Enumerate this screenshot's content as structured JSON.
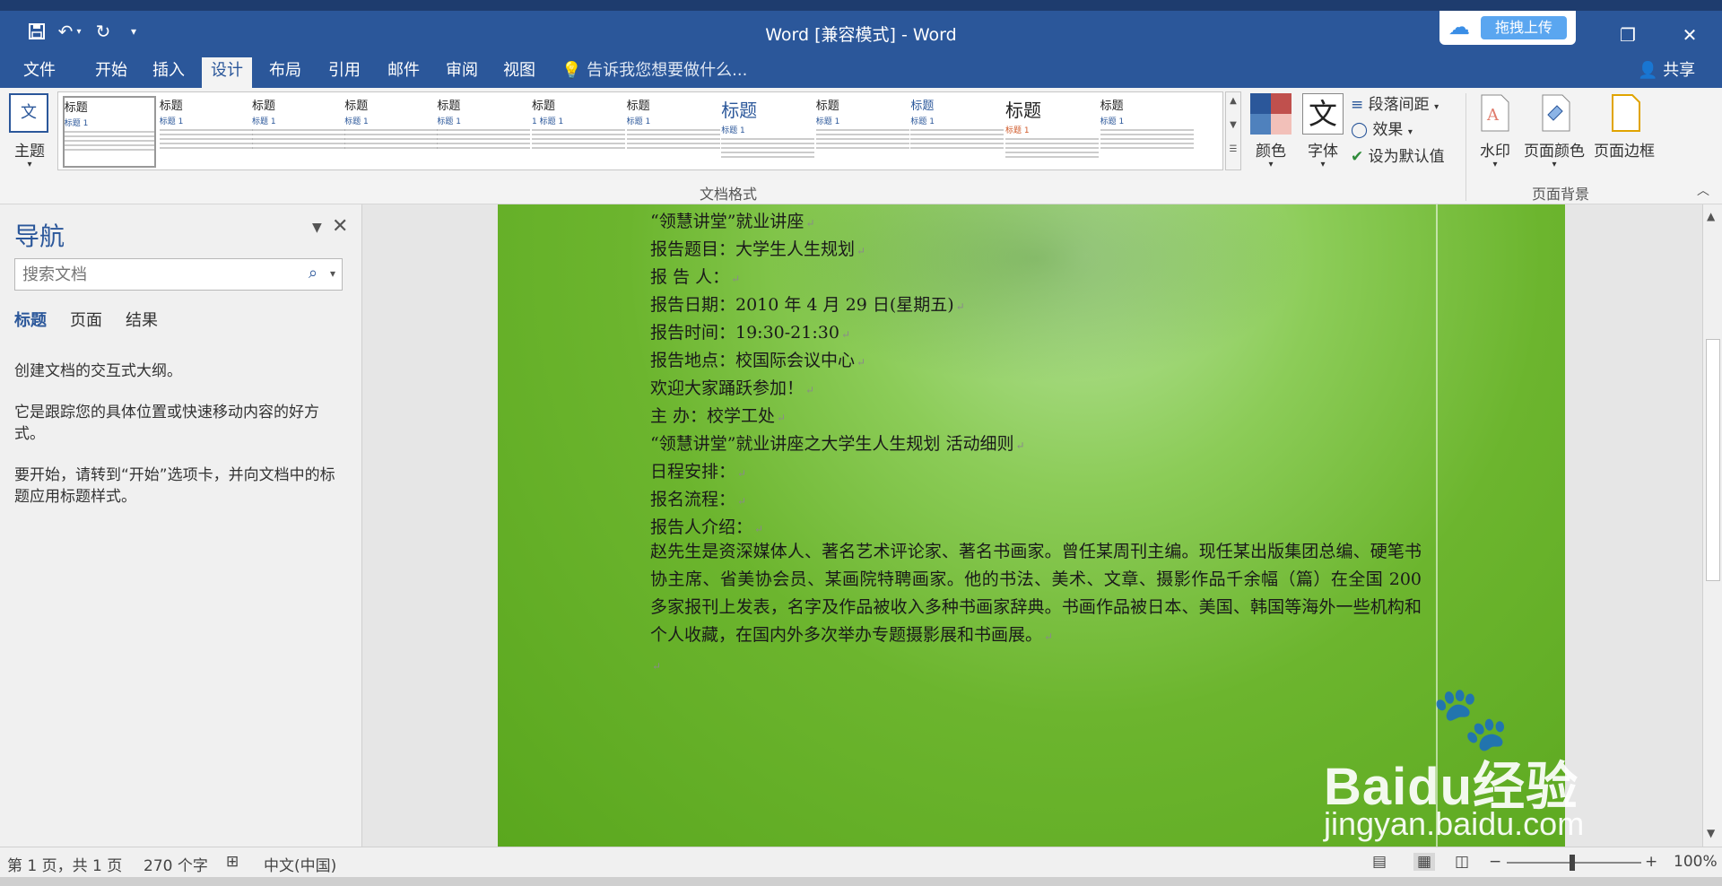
{
  "window": {
    "title": "Word [兼容模式] - Word",
    "upload_label": "拖拽上传"
  },
  "tabs": [
    {
      "label": "文件"
    },
    {
      "label": "开始"
    },
    {
      "label": "插入"
    },
    {
      "label": "设计"
    },
    {
      "label": "布局"
    },
    {
      "label": "引用"
    },
    {
      "label": "邮件"
    },
    {
      "label": "审阅"
    },
    {
      "label": "视图"
    }
  ],
  "tell_me": "告诉我您想要做什么...",
  "share": "共享",
  "ribbon": {
    "theme": "主题",
    "gallery_thumbs": [
      {
        "title": "标题",
        "sub": "标题 1"
      },
      {
        "title": "标题",
        "sub": "标题 1"
      },
      {
        "title": "标题",
        "sub": "标题 1"
      },
      {
        "title": "标题",
        "sub": "标题 1"
      },
      {
        "title": "标题",
        "sub": "标题 1"
      },
      {
        "title": "标题",
        "sub": "1 标题 1"
      },
      {
        "title": "标题",
        "sub": "标题 1"
      },
      {
        "title": "标题",
        "sub": "标题 1"
      },
      {
        "title": "标题",
        "sub": "标题 1"
      },
      {
        "title": "标题",
        "sub": "标题 1"
      },
      {
        "title": "标题",
        "sub": "标题 1"
      },
      {
        "title": "标题",
        "sub": "标题 1"
      }
    ],
    "colors": "颜色",
    "fonts": "字体",
    "fonts_glyph": "文",
    "paragraph_spacing": "段落间距",
    "effects": "效果",
    "set_default": "设为默认值",
    "watermark": "水印",
    "page_color": "页面颜色",
    "page_border": "页面边框",
    "group_doc_format": "文档格式",
    "group_page_bg": "页面背景"
  },
  "nav": {
    "title": "导航",
    "search_placeholder": "搜索文档",
    "tabs": [
      "标题",
      "页面",
      "结果"
    ],
    "text1": "创建文档的交互式大纲。",
    "text2": "它是跟踪您的具体位置或快速移动内容的好方式。",
    "text3": "要开始，请转到“开始”选项卡，并向文档中的标题应用标题样式。"
  },
  "doc": {
    "lines": [
      "“领慧讲堂”就业讲座",
      "报告题目：大学生人生规划",
      "报 告 人：",
      "报告日期：2010 年 4 月 29 日(星期五)",
      "报告时间：19:30-21:30",
      "报告地点：校国际会议中心",
      "欢迎大家踊跃参加！",
      "主 办：校学工处",
      "“领慧讲堂”就业讲座之大学生人生规划 活动细则",
      "日程安排：",
      "报名流程：",
      "报告人介绍："
    ],
    "paragraph": "赵先生是资深媒体人、著名艺术评论家、著名书画家。曾任某周刊主编。现任某出版集团总编、硬笔书协主席、省美协会员、某画院特聘画家。他的书法、美术、文章、摄影作品千余幅（篇）在全国 200 多家报刊上发表，名字及作品被收入多种书画家辞典。书画作品被日本、美国、韩国等海外一些机构和个人收藏，在国内外多次举办专题摄影展和书画展。",
    "para_mark": "↵"
  },
  "watermark": {
    "text": "Baidu经验",
    "url": "jingyan.baidu.com"
  },
  "status": {
    "page": "第 1 页，共 1 页",
    "words": "270 个字",
    "lang": "中文(中国)",
    "zoom": "100%"
  },
  "colors": {
    "word_blue": "#2b579a",
    "page_green": "#6cb52e"
  }
}
